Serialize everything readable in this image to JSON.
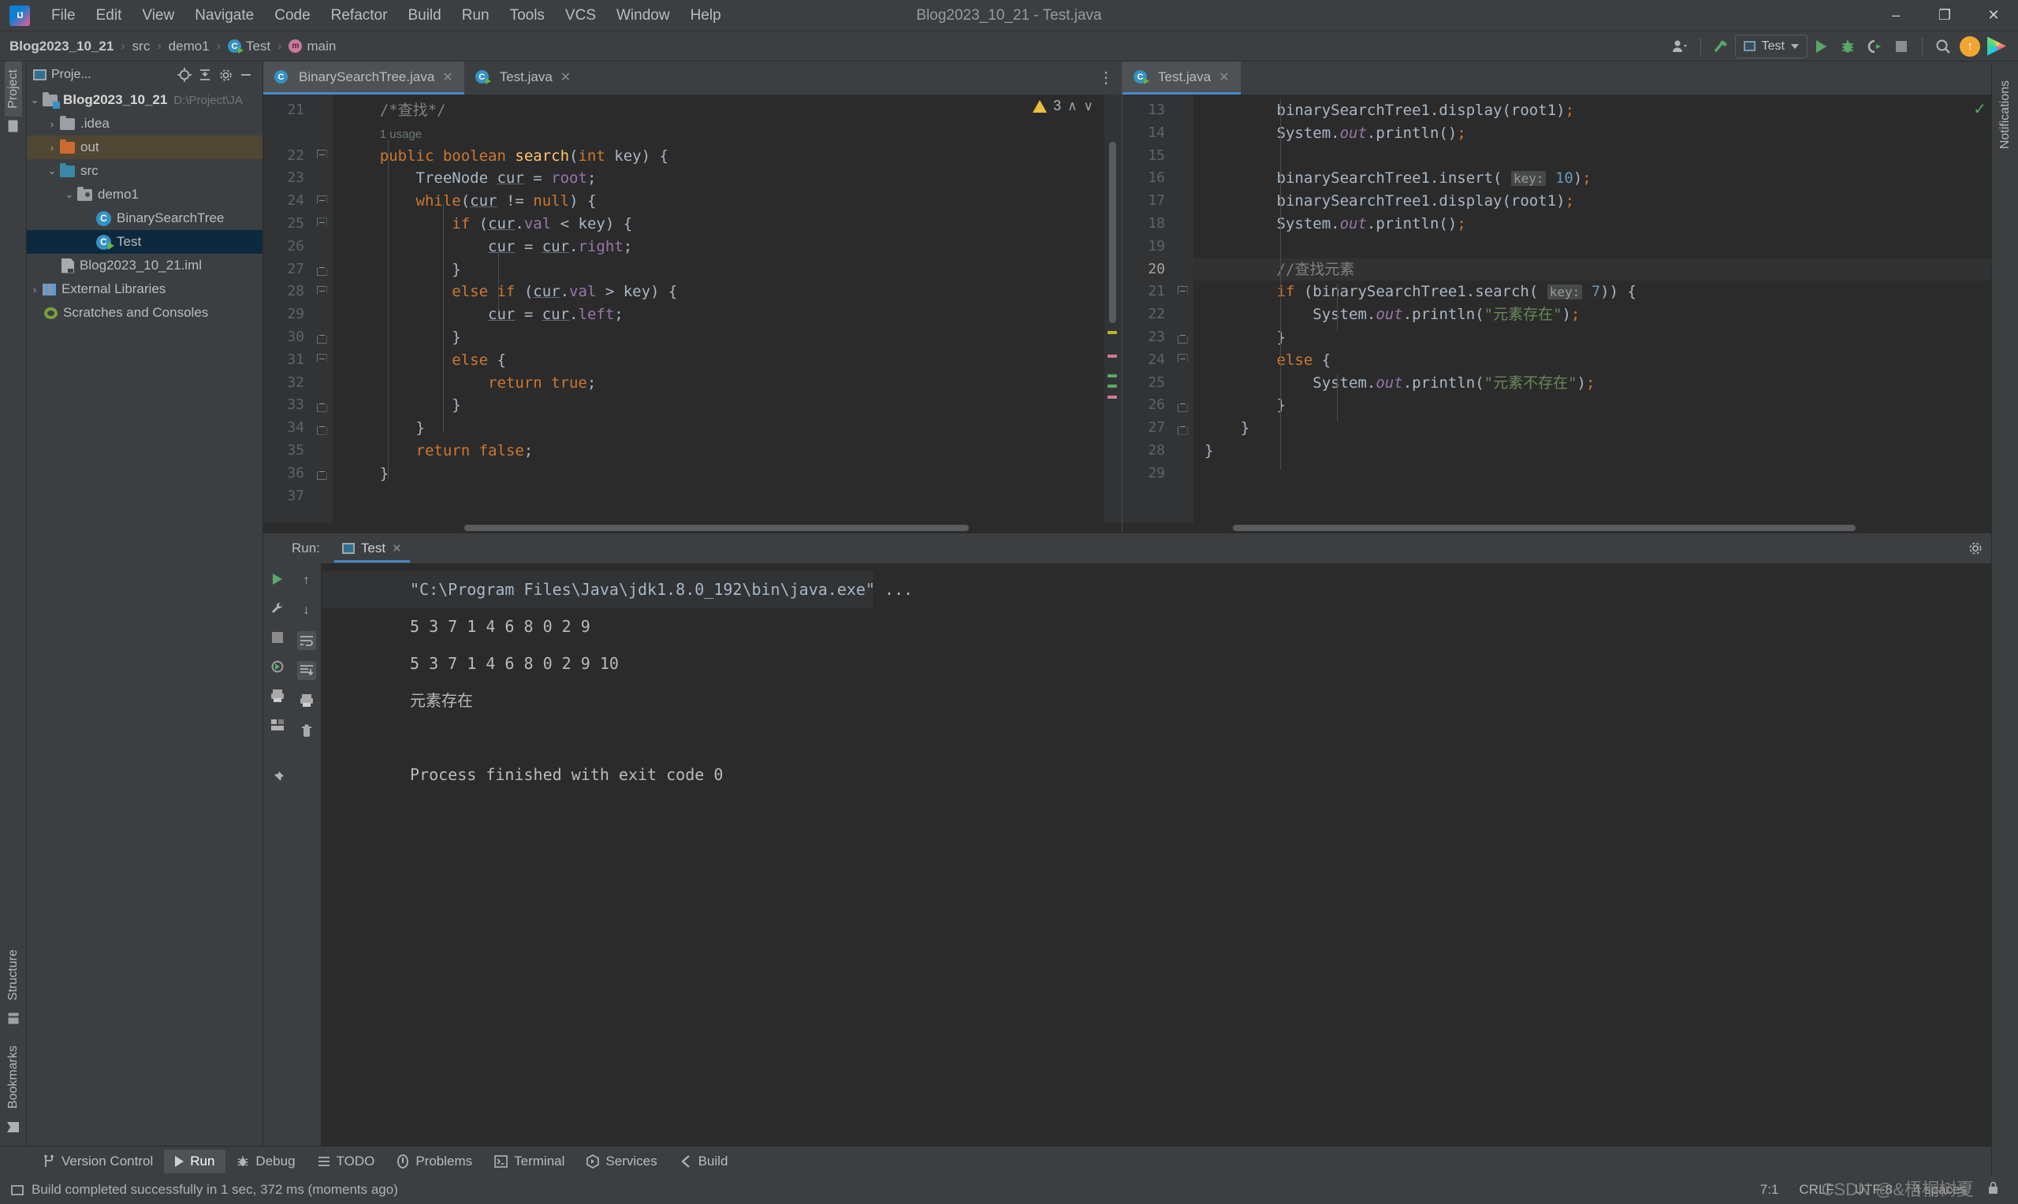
{
  "window": {
    "title": "Blog2023_10_21 - Test.java",
    "minimize": "–",
    "maximize": "❐",
    "close": "✕"
  },
  "menubar": {
    "items": [
      "File",
      "Edit",
      "View",
      "Navigate",
      "Code",
      "Refactor",
      "Build",
      "Run",
      "Tools",
      "VCS",
      "Window",
      "Help"
    ]
  },
  "breadcrumb": {
    "project": "Blog2023_10_21",
    "src": "src",
    "package": "demo1",
    "class": "Test",
    "method": "main",
    "sep": "›"
  },
  "toolbar": {
    "run_config": "Test",
    "account_icon": "account-icon",
    "build_icon": "build-hammer-icon",
    "run_icon": "run-icon",
    "debug_icon": "debug-icon",
    "coverage_icon": "run-with-coverage-icon",
    "stop_icon": "stop-icon",
    "search_icon": "⚲",
    "update_icon": "↑",
    "ide_icon": "ide-feature-trainer-icon"
  },
  "project_panel": {
    "title": "Proje...",
    "locate_icon": "locate-target-icon",
    "collapse_icon": "collapse-all-icon",
    "settings_icon": "gear-icon",
    "hide_icon": "hide-icon",
    "tree": [
      {
        "label": "Blog2023_10_21",
        "path": "D:\\Project\\JA",
        "icon": "project-folder",
        "arrow": "⌄",
        "depth": 0,
        "bold": true,
        "state": "none"
      },
      {
        "label": ".idea",
        "icon": "folder-gray",
        "arrow": "›",
        "depth": 1,
        "bold": false,
        "state": "none"
      },
      {
        "label": "out",
        "icon": "folder-orange",
        "arrow": "›",
        "depth": 1,
        "bold": false,
        "state": "dir-selected"
      },
      {
        "label": "src",
        "icon": "folder-blue",
        "arrow": "⌄",
        "depth": 1,
        "bold": false,
        "state": "none"
      },
      {
        "label": "demo1",
        "icon": "folder-package",
        "arrow": "⌄",
        "depth": 2,
        "bold": false,
        "state": "none"
      },
      {
        "label": "BinarySearchTree",
        "icon": "class-file",
        "arrow": "",
        "depth": 3,
        "bold": false,
        "state": "none"
      },
      {
        "label": "Test",
        "icon": "class-file-runnable",
        "arrow": "",
        "depth": 3,
        "bold": false,
        "state": "file-selected"
      },
      {
        "label": "Blog2023_10_21.iml",
        "icon": "iml-file",
        "arrow": "",
        "depth": 2,
        "bold": false,
        "state": "none"
      },
      {
        "label": "External Libraries",
        "icon": "library",
        "arrow": "›",
        "depth": 0,
        "bold": false,
        "state": "none"
      },
      {
        "label": "Scratches and Consoles",
        "icon": "scratches",
        "arrow": "",
        "depth": 0,
        "bold": false,
        "state": "none"
      }
    ]
  },
  "left_strip": {
    "project_tab": "Project",
    "structure_tab": "Structure",
    "bookmarks_tab": "Bookmarks"
  },
  "right_strip": {
    "notifications_tab": "Notifications"
  },
  "editor_left": {
    "tabs": [
      {
        "label": "BinarySearchTree.java",
        "active": true,
        "icon": "class-file",
        "close": "✕"
      },
      {
        "label": "Test.java",
        "active": false,
        "icon": "class-file-runnable",
        "close": "✕"
      }
    ],
    "warning_count": "3",
    "warning_icon": "warning-triangle-icon",
    "up_arrow": "∧",
    "down_arrow": "∨",
    "first_line": 21,
    "lines": [
      {
        "n": 21,
        "fold": "",
        "html": "    <span class='cmt'>/*查找*/</span>"
      },
      {
        "n": "",
        "fold": "",
        "html": "    <span class='hint'>1 usage</span>"
      },
      {
        "n": 22,
        "fold": "open",
        "html": "    <span class='kw'>public</span> <span class='kw'>boolean</span> <span class='fn'>search</span><span class='stat'>(</span><span class='kw'>int</span> <span class='stat'>key) {</span>"
      },
      {
        "n": 23,
        "fold": "",
        "html": "        <span class='stat'>TreeNode</span> <span class='loc'>cur</span> <span class='stat'>=</span> <span class='fld'>root</span><span class='stat'>;</span>"
      },
      {
        "n": 24,
        "fold": "open",
        "html": "        <span class='kw'>while</span><span class='stat'>(</span><span class='loc'>cur</span> <span class='stat'>!=</span> <span class='kw'>null</span><span class='stat'>) {</span>"
      },
      {
        "n": 25,
        "fold": "open",
        "html": "            <span class='kw'>if</span> <span class='stat'>(</span><span class='loc'>cur</span><span class='stat'>.</span><span class='fld'>val</span> <span class='stat'>&lt; key) {</span>"
      },
      {
        "n": 26,
        "fold": "",
        "html": "                <span class='loc'>cur</span> <span class='stat'>=</span> <span class='loc'>cur</span><span class='stat'>.</span><span class='fld'>right</span><span class='stat'>;</span>"
      },
      {
        "n": 27,
        "fold": "close",
        "html": "            <span class='stat'>}</span>"
      },
      {
        "n": 28,
        "fold": "open",
        "html": "            <span class='kw'>else if</span> <span class='stat'>(</span><span class='loc'>cur</span><span class='stat'>.</span><span class='fld'>val</span> <span class='stat'>&gt; key) {</span>"
      },
      {
        "n": 29,
        "fold": "",
        "html": "                <span class='loc'>cur</span> <span class='stat'>=</span> <span class='loc'>cur</span><span class='stat'>.</span><span class='fld'>left</span><span class='stat'>;</span>"
      },
      {
        "n": 30,
        "fold": "close",
        "html": "            <span class='stat'>}</span>"
      },
      {
        "n": 31,
        "fold": "open",
        "html": "            <span class='kw'>else</span> <span class='stat'>{</span>"
      },
      {
        "n": 32,
        "fold": "",
        "html": "                <span class='kw'>return true</span><span class='stat'>;</span>"
      },
      {
        "n": 33,
        "fold": "close",
        "html": "            <span class='stat'>}</span>"
      },
      {
        "n": 34,
        "fold": "close",
        "html": "        <span class='stat'>}</span>"
      },
      {
        "n": 35,
        "fold": "",
        "html": "        <span class='kw'>return false</span><span class='stat'>;</span>"
      },
      {
        "n": 36,
        "fold": "close",
        "html": "    <span class='stat'>}</span>"
      },
      {
        "n": 37,
        "fold": "",
        "html": ""
      }
    ]
  },
  "editor_right": {
    "tabs": [
      {
        "label": "Test.java",
        "active": true,
        "icon": "class-file-runnable",
        "close": "✕"
      }
    ],
    "ok_icon": "✓",
    "options_icon": "more-options-icon",
    "current_line": 20,
    "lines": [
      {
        "n": 13,
        "fold": "",
        "cur": false,
        "html": "        <span class='stat'>binarySearchTree1.</span><span class='stat'>display(root1)</span><span class='kw'>;</span>"
      },
      {
        "n": 14,
        "fold": "",
        "cur": false,
        "html": "        <span class='stat'>System.</span><span class='fld'><i>out</i></span><span class='stat'>.println()</span><span class='kw'>;</span>"
      },
      {
        "n": 15,
        "fold": "",
        "cur": false,
        "html": ""
      },
      {
        "n": 16,
        "fold": "",
        "cur": false,
        "html": "        <span class='stat'>binarySearchTree1.insert(</span> <span class='param'>key:</span> <span class='num'>10</span><span class='stat'>)</span><span class='kw'>;</span>"
      },
      {
        "n": 17,
        "fold": "",
        "cur": false,
        "html": "        <span class='stat'>binarySearchTree1.display(root1)</span><span class='kw'>;</span>"
      },
      {
        "n": 18,
        "fold": "",
        "cur": false,
        "html": "        <span class='stat'>System.</span><span class='fld'><i>out</i></span><span class='stat'>.println()</span><span class='kw'>;</span>"
      },
      {
        "n": 19,
        "fold": "",
        "cur": false,
        "html": ""
      },
      {
        "n": 20,
        "fold": "",
        "cur": true,
        "html": "        <span class='cmt'>//查找元素</span>"
      },
      {
        "n": 21,
        "fold": "open",
        "cur": false,
        "html": "        <span class='kw'>if</span> <span class='stat'>(binarySearchTree1.search(</span> <span class='param'>key:</span> <span class='num'>7</span><span class='stat'>)) {</span>"
      },
      {
        "n": 22,
        "fold": "",
        "cur": false,
        "html": "            <span class='stat'>System.</span><span class='fld'><i>out</i></span><span class='stat'>.println(</span><span class='str'>\"元素存在\"</span><span class='stat'>)</span><span class='kw'>;</span>"
      },
      {
        "n": 23,
        "fold": "close",
        "cur": false,
        "html": "        <span class='stat'>}</span>"
      },
      {
        "n": 24,
        "fold": "open",
        "cur": false,
        "html": "        <span class='kw'>else</span> <span class='stat'>{</span>"
      },
      {
        "n": 25,
        "fold": "",
        "cur": false,
        "html": "            <span class='stat'>System.</span><span class='fld'><i>out</i></span><span class='stat'>.println(</span><span class='str'>\"元素不存在\"</span><span class='stat'>)</span><span class='kw'>;</span>"
      },
      {
        "n": 26,
        "fold": "close",
        "cur": false,
        "html": "        <span class='stat'>}</span>"
      },
      {
        "n": 27,
        "fold": "close",
        "cur": false,
        "html": "    <span class='stat'>}</span>"
      },
      {
        "n": 28,
        "fold": "",
        "cur": false,
        "html": "<span class='stat'>}</span>"
      },
      {
        "n": 29,
        "fold": "",
        "cur": false,
        "html": ""
      }
    ]
  },
  "run_window": {
    "label": "Run:",
    "tab": "Test",
    "tab_close": "✕",
    "settings_icon": "gear-icon",
    "hide_icon": "–",
    "tool_icons": [
      "rerun-icon",
      "wrench-icon",
      "stop-icon",
      "rerun-failed-icon",
      "print-icon",
      "layout-icon",
      "pin-icon"
    ],
    "nav_icons": [
      "up-arrow-icon",
      "down-arrow-icon",
      "soft-wrap-icon",
      "scroll-to-end-icon",
      "print-icon",
      "trash-icon"
    ],
    "console": [
      {
        "text": "\"C:\\Program Files\\Java\\jdk1.8.0_192\\bin\\java.exe\" ...",
        "style": "cmd"
      },
      {
        "text": "5 3 7 1 4 6 8 0 2 9 ",
        "style": "out"
      },
      {
        "text": "5 3 7 1 4 6 8 0 2 9 10 ",
        "style": "out"
      },
      {
        "text": "元素存在",
        "style": "out"
      },
      {
        "text": "",
        "style": "out"
      },
      {
        "text": "Process finished with exit code 0",
        "style": "out"
      }
    ]
  },
  "status_tabs": [
    {
      "label": "Version Control",
      "icon": "branch-icon",
      "active": false
    },
    {
      "label": "Run",
      "icon": "run-icon",
      "active": true
    },
    {
      "label": "Debug",
      "icon": "debug-icon",
      "active": false
    },
    {
      "label": "TODO",
      "icon": "todo-icon",
      "active": false
    },
    {
      "label": "Problems",
      "icon": "problems-icon",
      "active": false
    },
    {
      "label": "Terminal",
      "icon": "terminal-icon",
      "active": false
    },
    {
      "label": "Services",
      "icon": "services-icon",
      "active": false
    },
    {
      "label": "Build",
      "icon": "build-icon",
      "active": false
    }
  ],
  "status_bar": {
    "message": "Build completed successfully in 1 sec, 372 ms (moments ago)",
    "message_icon": "event-log-icon",
    "caret": "7:1",
    "line_sep": "CRLF",
    "encoding": "UTF-8",
    "indent": "4 spaces",
    "lock_icon": "lock-icon",
    "watermark": "CSDN @&梧桐树夏"
  }
}
